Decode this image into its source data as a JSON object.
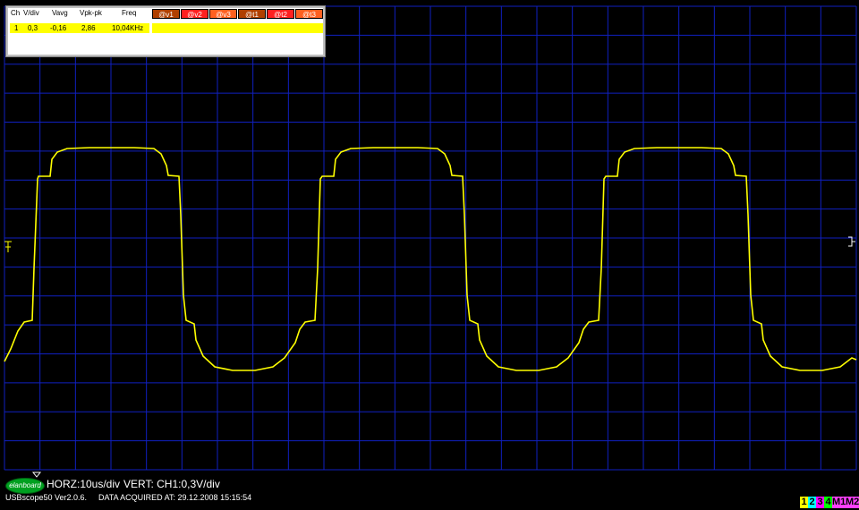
{
  "measurements": {
    "headers": [
      "Ch",
      "V/div",
      "Vavg",
      "Vpk-pk",
      "Freq"
    ],
    "markers": [
      {
        "label": "@v1",
        "color": "#b04000"
      },
      {
        "label": "@v2",
        "color": "#ff2020"
      },
      {
        "label": "@v3",
        "color": "#ff6020"
      },
      {
        "label": "@t1",
        "color": "#b04000"
      },
      {
        "label": "@t2",
        "color": "#ff2020"
      },
      {
        "label": "@t3",
        "color": "#ff6020"
      }
    ],
    "row": {
      "ch": "1",
      "vdiv": "0,3",
      "vavg": "-0,16",
      "vpkpk": "2,86",
      "freq": "10,04KHz"
    }
  },
  "status": {
    "horz": "HORZ:10us/div",
    "vert": "VERT: CH1:0,3V/div",
    "version": "USBscope50 Ver2.0.6.",
    "acquired": "DATA ACQUIRED AT: 29.12.2008 15:15:54",
    "logo": "elanboard"
  },
  "channels": [
    {
      "label": "1",
      "color": "#ffff00"
    },
    {
      "label": "2",
      "color": "#00ffff"
    },
    {
      "label": "3",
      "color": "#ff00ff"
    },
    {
      "label": "4",
      "color": "#00ff00"
    },
    {
      "label": "M1",
      "color": "#ff40ff"
    },
    {
      "label": "M2",
      "color": "#ff40ff"
    }
  ],
  "trace_color": "#ffff00",
  "grid_color": "#1020c0"
}
